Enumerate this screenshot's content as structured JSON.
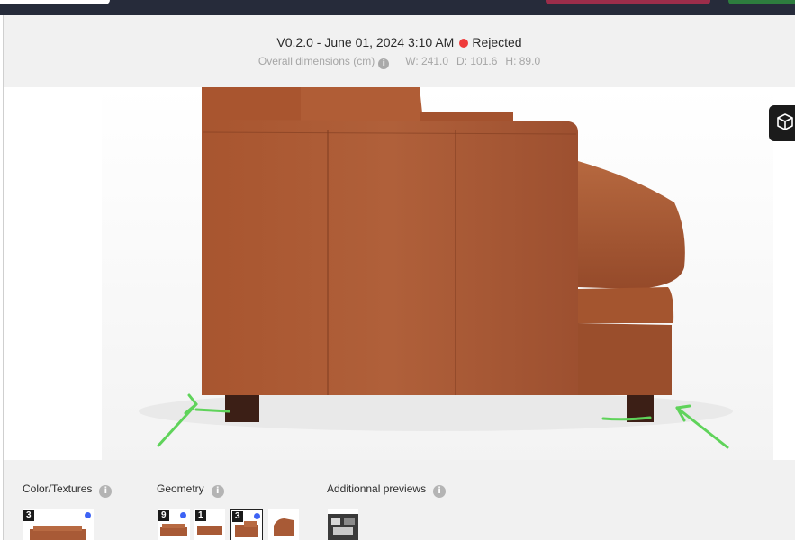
{
  "header": {
    "version": "V0.2.0 - June 01, 2024 3:10 AM",
    "status": "Rejected",
    "status_color": "#ef3b3b",
    "dims_label": "Overall dimensions (cm)",
    "width": "W: 241.0",
    "depth": "D: 101.6",
    "height": "H: 89.0"
  },
  "viewer": {
    "toggle_icon": "cube-icon",
    "annotation_color": "#5fd35a"
  },
  "sections": {
    "color_textures": {
      "title": "Color/Textures",
      "thumbnails": [
        {
          "count": "3",
          "has_dot": true
        }
      ]
    },
    "geometry": {
      "title": "Geometry",
      "thumbnails": [
        {
          "count": "9",
          "has_dot": true
        },
        {
          "count": "1",
          "has_dot": false
        },
        {
          "count": "3",
          "has_dot": true,
          "selected": true
        },
        {
          "count": "",
          "has_dot": false
        }
      ]
    },
    "additional_previews": {
      "title": "Additionnal previews"
    }
  },
  "colors": {
    "accent_dot": "#3d63f5",
    "leather": "#a85a36"
  }
}
